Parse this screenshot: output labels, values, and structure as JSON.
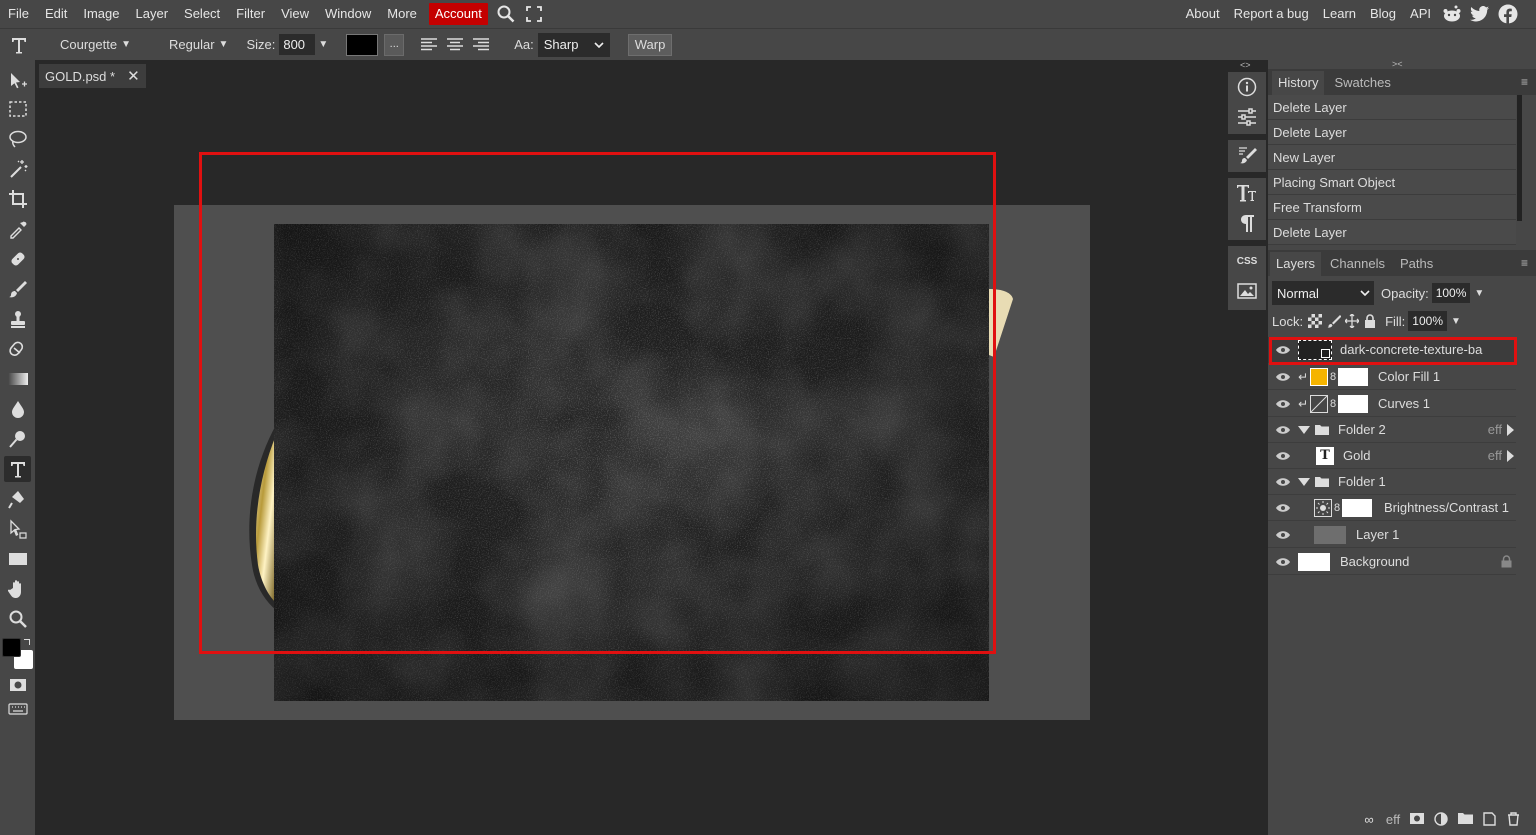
{
  "menu": {
    "items": [
      "File",
      "Edit",
      "Image",
      "Layer",
      "Select",
      "Filter",
      "View",
      "Window",
      "More"
    ],
    "account": "Account",
    "right": [
      "About",
      "Report a bug",
      "Learn",
      "Blog",
      "API"
    ],
    "social_icons": [
      "reddit-icon",
      "twitter-icon",
      "facebook-icon"
    ]
  },
  "options": {
    "font": "Courgette",
    "style": "Regular",
    "size_label": "Size:",
    "size_value": "800 p",
    "more_btn": "...",
    "aa_label": "Aa:",
    "aa_value": "Sharp",
    "warp": "Warp"
  },
  "document": {
    "tab": "GOLD.psd *",
    "close": "✕"
  },
  "history": {
    "tabs": [
      "History",
      "Swatches"
    ],
    "items": [
      "Delete Layer",
      "Delete Layer",
      "New Layer",
      "Placing Smart Object",
      "Free Transform",
      "Delete Layer"
    ]
  },
  "layers_panel": {
    "tabs": [
      "Layers",
      "Channels",
      "Paths"
    ],
    "blend_mode": "Normal",
    "opacity_label": "Opacity:",
    "opacity": "100%",
    "lock_label": "Lock:",
    "fill_label": "Fill:",
    "fill": "100%",
    "layers": [
      {
        "name": "dark-concrete-texture-ba",
        "selected": true
      },
      {
        "name": "Color Fill 1"
      },
      {
        "name": "Curves 1"
      },
      {
        "name": "Folder 2",
        "eff": "eff"
      },
      {
        "name": "Gold",
        "eff": "eff"
      },
      {
        "name": "Folder 1"
      },
      {
        "name": "Brightness/Contrast 1"
      },
      {
        "name": "Layer 1"
      },
      {
        "name": "Background"
      }
    ],
    "bottom": [
      "eff"
    ]
  },
  "colors": {
    "accent_red": "#c40000",
    "selection_outline": "#e01010",
    "color_fill_swatch": "#f5b400"
  }
}
